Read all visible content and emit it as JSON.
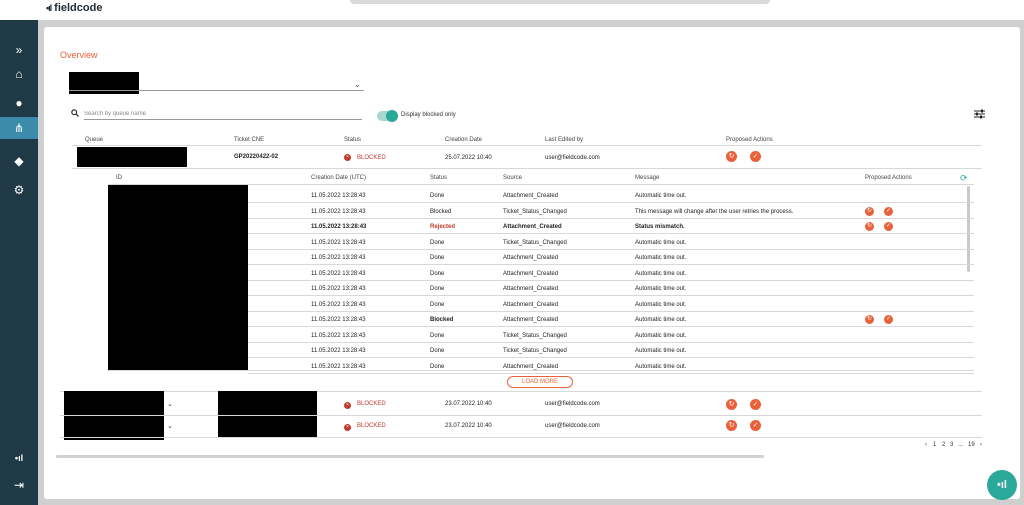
{
  "app": {
    "logo_mark": "•ıl",
    "logo_text": "fieldcode"
  },
  "sidebar": {
    "items": [
      {
        "icon": "expand-icon",
        "glyph": "»"
      },
      {
        "icon": "home-icon",
        "glyph": "⌂"
      },
      {
        "icon": "user-icon",
        "glyph": "●"
      },
      {
        "icon": "workflow-icon",
        "glyph": "⋔"
      },
      {
        "icon": "car-icon",
        "glyph": "◆"
      },
      {
        "icon": "settings-icon",
        "glyph": "⚙"
      }
    ],
    "bottom": [
      {
        "icon": "fieldcode-icon",
        "glyph": "•ıl"
      },
      {
        "icon": "logout-icon",
        "glyph": "⇥"
      }
    ]
  },
  "overview": {
    "title": "Overview"
  },
  "search": {
    "placeholder": "Search by queue name"
  },
  "toggle": {
    "label": "Display blocked only",
    "on": true
  },
  "table": {
    "headers": {
      "queue": "Queue",
      "ticket": "Ticket CNE",
      "status": "Status",
      "created": "Creation Date",
      "edited": "Last Edited by",
      "actions": "Proposed Actions"
    },
    "rows": [
      {
        "ticket": "GP20220422-02",
        "status": "BLOCKED",
        "created": "25.07.2022 10:40",
        "edited": "user@fieldcode.com"
      },
      {
        "ticket": "",
        "status": "BLOCKED",
        "created": "23.07.2022 10:40",
        "edited": "user@fieldcode.com"
      },
      {
        "ticket": "",
        "status": "BLOCKED",
        "created": "23.07.2022 10:40",
        "edited": "user@fieldcode.com"
      }
    ]
  },
  "subtable": {
    "headers": {
      "id": "ID",
      "created": "Creation Date (UTC)",
      "status": "Status",
      "source": "Source",
      "message": "Message",
      "actions": "Proposed Actions"
    },
    "rows": [
      {
        "created": "11.05.2022 13:28:43",
        "status": "Done",
        "source": "Attachment_Created",
        "message": "Automatic time out."
      },
      {
        "created": "11.05.2022 13:28:43",
        "status": "Blocked",
        "source": "Ticket_Status_Changed",
        "message": "This message will change after the user retries the process."
      },
      {
        "created": "11.05.2022 13:28:43",
        "status": "Rejected",
        "source": "Attachment_Created",
        "message": "Status mismatch."
      },
      {
        "created": "11.05.2022 13:28:43",
        "status": "Done",
        "source": "Ticket_Status_Changed",
        "message": "Automatic time out."
      },
      {
        "created": "11.05.2022 13:28:43",
        "status": "Done",
        "source": "Attachment_Created",
        "message": "Automatic time out."
      },
      {
        "created": "11.05.2022 13:28:43",
        "status": "Done",
        "source": "Attachment_Created",
        "message": "Automatic time out."
      },
      {
        "created": "11.05.2022 13:28:43",
        "status": "Done",
        "source": "Attachment_Created",
        "message": "Automatic time out."
      },
      {
        "created": "11.05.2022 13:28:43",
        "status": "Done",
        "source": "Attachment_Created",
        "message": "Automatic time out."
      },
      {
        "created": "11.05.2022 13:28:43",
        "status": "Blocked",
        "source": "Attachment_Created",
        "message": "Automatic time out."
      },
      {
        "created": "11.05.2022 13:28:43",
        "status": "Done",
        "source": "Ticket_Status_Changed",
        "message": "Automatic time out."
      },
      {
        "created": "11.05.2022 13:28:43",
        "status": "Done",
        "source": "Ticket_Status_Changed",
        "message": "Automatic time out."
      },
      {
        "created": "11.05.2022 13:28:43",
        "status": "Done",
        "source": "Attachment_Created",
        "message": "Automatic time out."
      }
    ],
    "load_more": "LOAD MORE"
  },
  "pagination": {
    "prev": "‹",
    "pages": [
      "1",
      "2",
      "3",
      "...",
      "19"
    ],
    "next": "›"
  },
  "colors": {
    "accent": "#e8613a",
    "teal": "#2aa89a",
    "sidebar": "#1f3a46",
    "blocked": "#c0392b"
  }
}
